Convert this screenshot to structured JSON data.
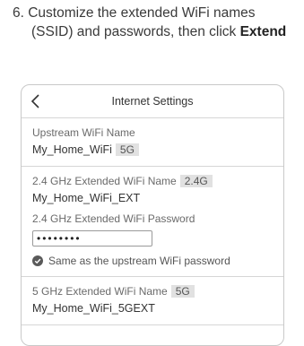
{
  "instruction": {
    "line1": "6. Customize the extended WiFi names",
    "line2_prefix": "(SSID) and passwords, then click ",
    "line2_bold": "Extend"
  },
  "screen": {
    "title": "Internet Settings",
    "back_icon": "chevron-left-icon",
    "upstream": {
      "label": "Upstream WiFi Name",
      "value": "My_Home_WiFi",
      "tag": "5G"
    },
    "ext24": {
      "name_label": "2.4 GHz Extended WiFi Name",
      "name_tag": "2.4G",
      "name_value": "My_Home_WiFi_EXT",
      "password_label": "2.4 GHz Extended WiFi Password",
      "password_value": "••••••••",
      "same_as_upstream_label": "Same as the upstream WiFi password",
      "same_as_upstream_checked": true
    },
    "ext5": {
      "name_label": "5 GHz Extended WiFi Name",
      "name_tag": "5G",
      "name_value": "My_Home_WiFi_5GEXT"
    }
  },
  "colors": {
    "tag_background": "#e1e1e1",
    "border": "#c9c9c9",
    "check": "#5a5a5a"
  }
}
